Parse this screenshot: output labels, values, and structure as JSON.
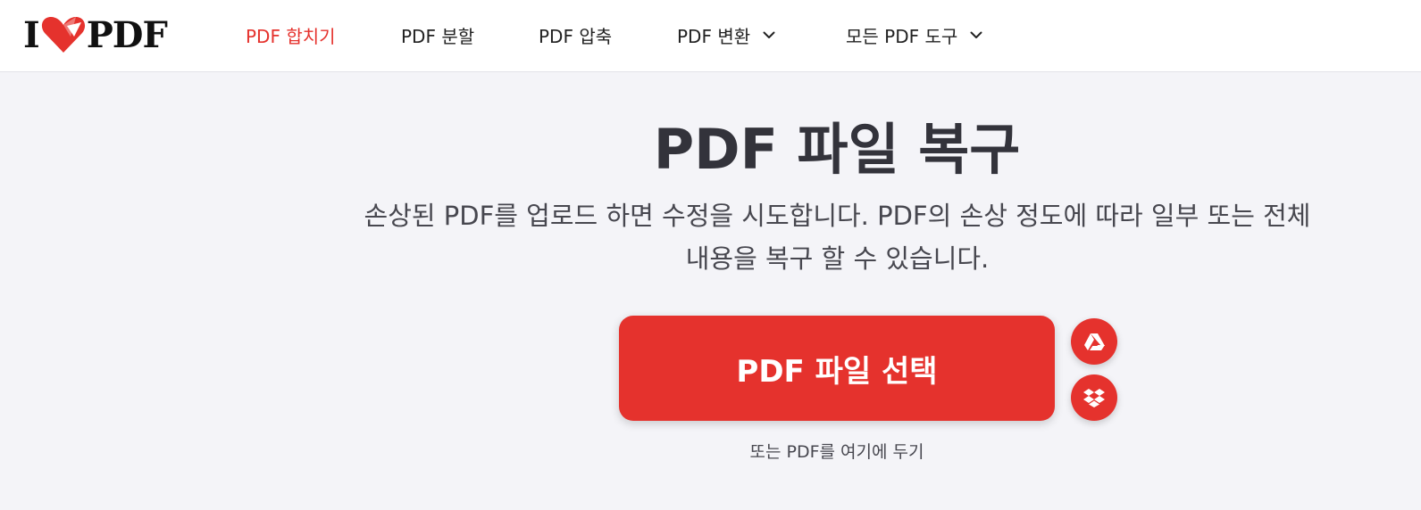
{
  "brand": {
    "logo_left": "I",
    "logo_right": "PDF",
    "accent_color": "#e5322d"
  },
  "nav": {
    "items": [
      {
        "label": "PDF 합치기",
        "active": true
      },
      {
        "label": "PDF 분할",
        "active": false
      },
      {
        "label": "PDF 압축",
        "active": false
      },
      {
        "label": "PDF 변환",
        "active": false,
        "dropdown": true
      },
      {
        "label": "모든 PDF 도구",
        "active": false,
        "dropdown": true
      }
    ]
  },
  "main": {
    "title": "PDF 파일 복구",
    "subtitle_line1": "손상된 PDF를 업로드 하면 수정을 시도합니다. PDF의 손상 정도에 따라 일부 또는 전체",
    "subtitle_line2": "내용을 복구 할 수 있습니다.",
    "select_button_label": "PDF 파일 선택",
    "drop_hint": "또는 PDF를 여기에 두기",
    "cloud_buttons": [
      {
        "icon": "google-drive-icon"
      },
      {
        "icon": "dropbox-icon"
      }
    ]
  }
}
